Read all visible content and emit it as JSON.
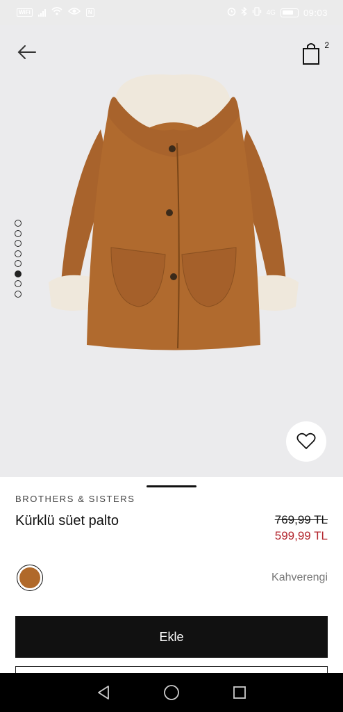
{
  "status_bar": {
    "carrier_badge": "WiFi",
    "network": "4G",
    "time": "09:03"
  },
  "header": {
    "cart_count": "2"
  },
  "gallery": {
    "image_count": 8,
    "active_index": 5
  },
  "product": {
    "brand": "BROTHERS & SISTERS",
    "name": "Kürklü süet palto",
    "old_price": "769,99 TL",
    "new_price": "599,99 TL",
    "color_name": "Kahverengi",
    "swatch_color": "#b0692a"
  },
  "actions": {
    "add_label": "Ekle"
  },
  "colors": {
    "price_sale": "#b3262e",
    "hero_bg": "#ebebed",
    "button_bg": "#111111"
  }
}
